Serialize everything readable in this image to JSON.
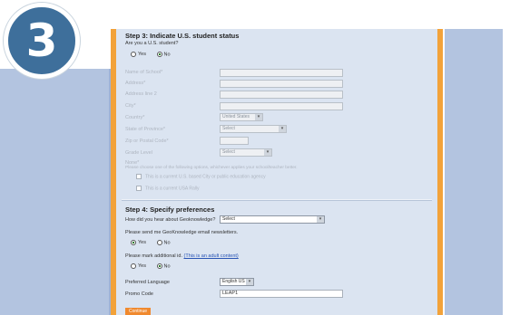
{
  "badge": {
    "number": "3"
  },
  "step3": {
    "title": "Step 3: Indicate U.S. student status",
    "question": "Are you a U.S. student?",
    "yes": "Yes",
    "no": "No",
    "fields": [
      {
        "label": "Name of School*"
      },
      {
        "label": "Address*"
      },
      {
        "label": "Address line 2"
      },
      {
        "label": "City*"
      },
      {
        "label": "Country*",
        "value": "United States"
      },
      {
        "label": "State of Province*",
        "value": "Select"
      },
      {
        "label": "Zip or Postal Code*"
      },
      {
        "label": "Grade Level",
        "value": "Select"
      }
    ],
    "note_label": "None*",
    "note_help": "Please choose one of the following options, whichever applies your school/teacher better.",
    "check1": "This is a current U.S. based City or public education agency",
    "check2": "This is a current USA Rally"
  },
  "step4": {
    "title": "Step 4: Specify preferences",
    "hear_label": "How did you hear about Geoknowledge?",
    "hear_value": "Select",
    "promo_label": "Please send me GeoKnowledge email newsletters.",
    "yes": "Yes",
    "no": "No",
    "adult_label_prefix": "Please mark additional id. ",
    "adult_label_link": "(This is an adult content)",
    "lang_label": "Preferred Language",
    "lang_value": "English US",
    "promo_code_label": "Promo Code",
    "promo_code_value": "LEAP1"
  },
  "continue_label": "Continue"
}
